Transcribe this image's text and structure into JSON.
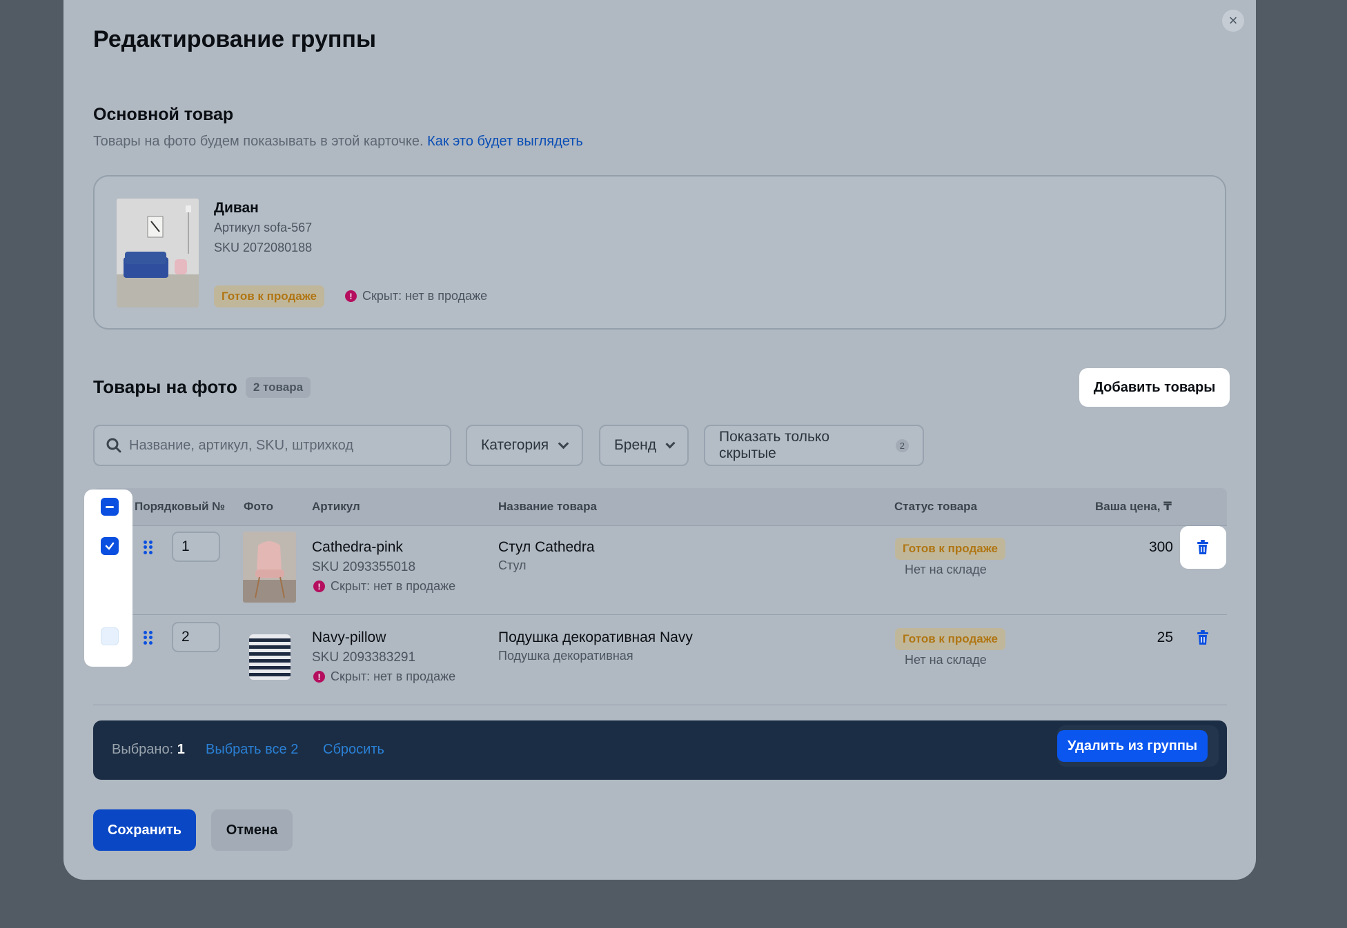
{
  "dialog": {
    "title": "Редактирование группы",
    "close_label": "×"
  },
  "main_product": {
    "section_title": "Основной товар",
    "subtitle": "Товары на фото будем показывать в этой карточке.",
    "subtitle_link": "Как это будет выглядеть",
    "name": "Диван",
    "article": "Артикул sofa-567",
    "sku": "SKU 2072080188",
    "status": "Готов к продаже",
    "hidden": "Скрыт: нет в продаже"
  },
  "photo_products": {
    "title": "Товары на фото",
    "count": "2 товара",
    "add_button": "Добавить товары"
  },
  "filters": {
    "search_placeholder": "Название, артикул, SKU, штрихкод",
    "category": "Категория",
    "brand": "Бренд",
    "hidden_only": "Показать только скрытые",
    "hidden_count": "2"
  },
  "table": {
    "columns": {
      "order": "Порядковый №",
      "photo": "Фото",
      "article": "Артикул",
      "name": "Название товара",
      "status": "Статус товара",
      "price": "Ваша цена, ₸"
    },
    "rows": [
      {
        "order": "1",
        "article": "Cathedra-pink",
        "sku": "SKU 2093355018",
        "hidden": "Скрыт: нет в продаже",
        "name": "Стул Cathedra",
        "category": "Стул",
        "status": "Готов к продаже",
        "stock": "Нет на складе",
        "price": "300",
        "checked": true
      },
      {
        "order": "2",
        "article": "Navy-pillow",
        "sku": "SKU 2093383291",
        "hidden": "Скрыт: нет в продаже",
        "name": "Подушка декоративная Navy",
        "category": "Подушка декоративная",
        "status": "Готов к продаже",
        "stock": "Нет на складе",
        "price": "25",
        "checked": false
      }
    ]
  },
  "selection_bar": {
    "selected_label": "Выбрано:",
    "selected_count": "1",
    "select_all": "Выбрать все 2",
    "reset": "Сбросить",
    "delete_button": "Удалить из группы"
  },
  "footer": {
    "save": "Сохранить",
    "cancel": "Отмена"
  },
  "colors": {
    "accent": "#0a4fe0",
    "warning": "#b50e5f",
    "ready_badge_text": "#b07512",
    "bar": "#1b2d44"
  }
}
